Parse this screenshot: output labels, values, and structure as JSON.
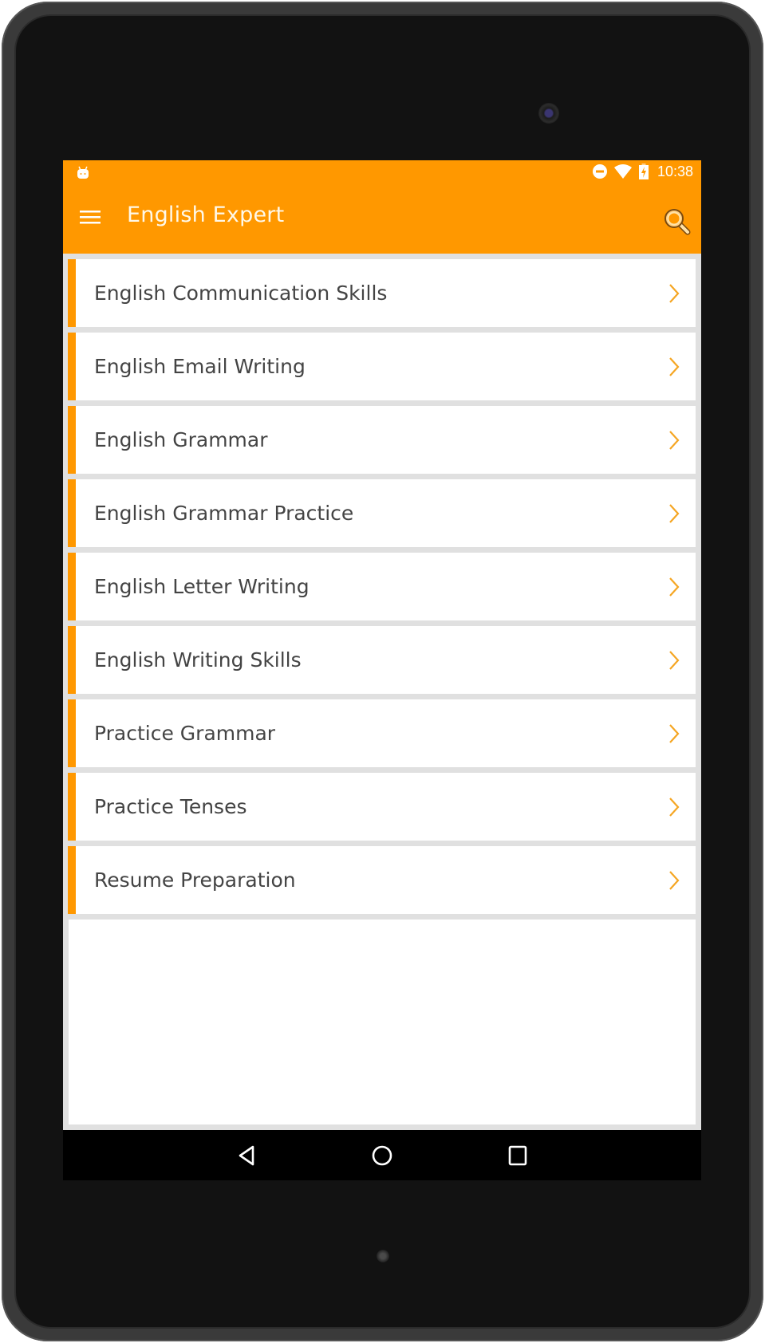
{
  "status_bar": {
    "time": "10:38",
    "icons": [
      "android-notification-icon",
      "do-not-disturb-icon",
      "wifi-icon",
      "battery-charging-icon"
    ]
  },
  "toolbar": {
    "title": "English Expert",
    "menu_icon": "hamburger-menu-icon",
    "search_icon": "search-icon"
  },
  "list": {
    "items": [
      {
        "label": "English Communication Skills"
      },
      {
        "label": "English Email Writing"
      },
      {
        "label": "English Grammar"
      },
      {
        "label": "English Grammar Practice"
      },
      {
        "label": "English Letter Writing"
      },
      {
        "label": "English Writing Skills"
      },
      {
        "label": "Practice Grammar"
      },
      {
        "label": "Practice Tenses"
      },
      {
        "label": "Resume Preparation"
      }
    ]
  },
  "nav_bar": {
    "buttons": [
      "back",
      "home",
      "recents"
    ]
  },
  "colors": {
    "primary": "#FF9800",
    "chevron": "#F5A623",
    "item_text": "#444444",
    "list_background": "#E0E0E0"
  }
}
